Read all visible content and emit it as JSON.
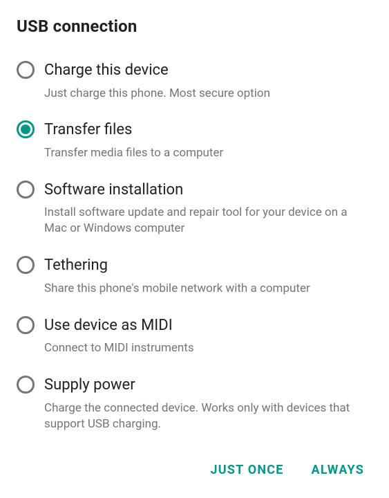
{
  "dialog": {
    "title": "USB connection",
    "options": [
      {
        "title": "Charge this device",
        "subtitle": "Just charge this phone. Most secure option",
        "selected": false
      },
      {
        "title": "Transfer files",
        "subtitle": "Transfer media files to a computer",
        "selected": true
      },
      {
        "title": "Software installation",
        "subtitle": "Install software update and repair tool for your device on a Mac or Windows computer",
        "selected": false
      },
      {
        "title": "Tethering",
        "subtitle": "Share this phone's mobile network with a computer",
        "selected": false
      },
      {
        "title": "Use device as MIDI",
        "subtitle": "Connect to MIDI instruments",
        "selected": false
      },
      {
        "title": "Supply power",
        "subtitle": "Charge the connected device. Works only with devices that support USB charging.",
        "selected": false
      }
    ],
    "actions": {
      "just_once": "JUST ONCE",
      "always": "ALWAYS"
    }
  }
}
